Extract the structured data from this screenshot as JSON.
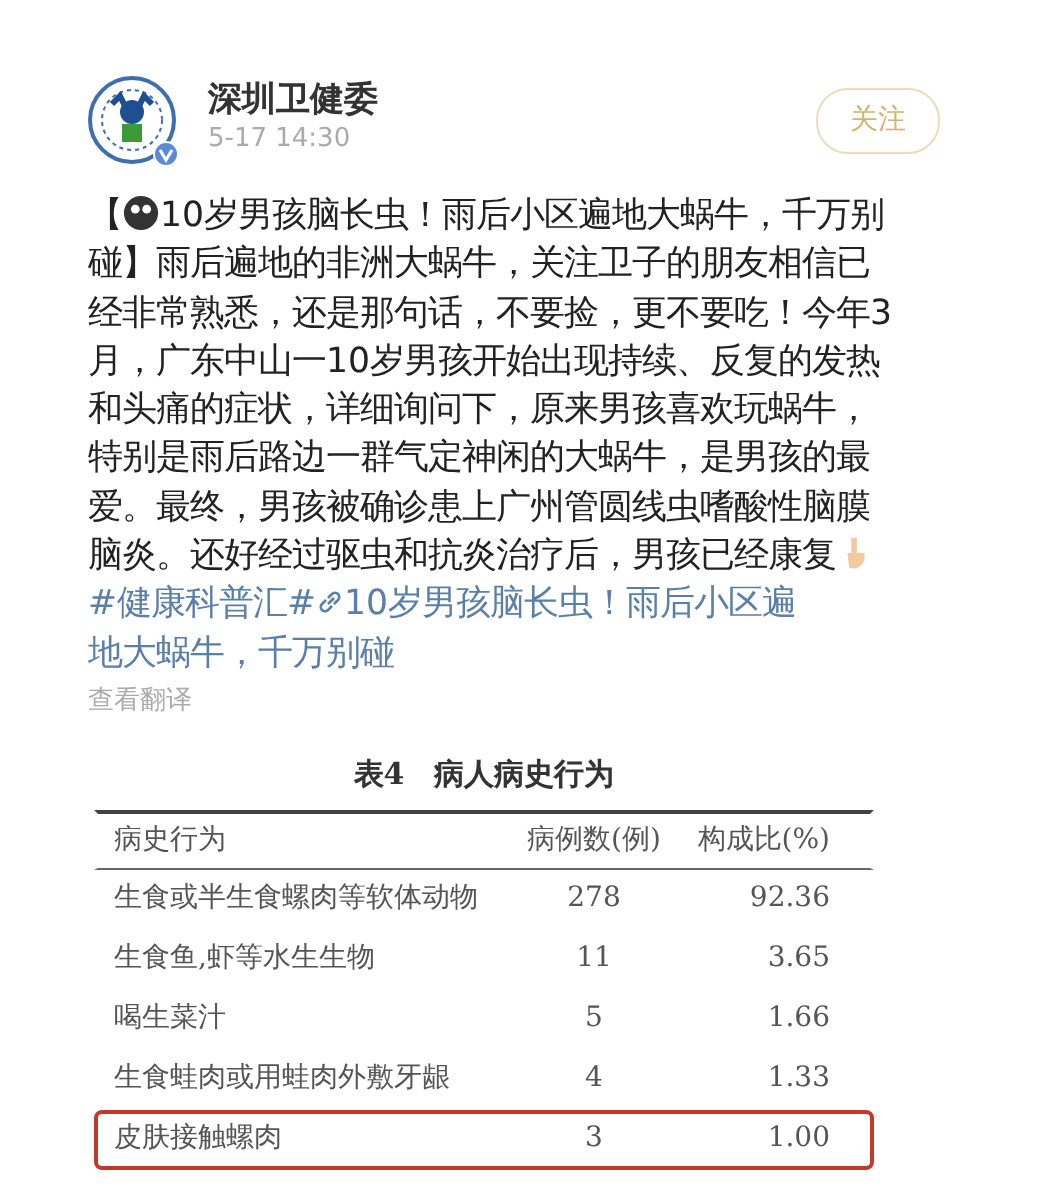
{
  "post": {
    "author": "深圳卫健委",
    "verified": true,
    "time": "5-17 14:30",
    "follow_button": "关注",
    "body": {
      "open_bracket": "【",
      "text": "10岁男孩脑长虫！雨后小区遍地大蜗牛，千万别碰】雨后遍地的非洲大蜗牛，关注卫子的朋友相信已经非常熟悉，还是那句话，不要捡，更不要吃！今年3月，广东中山一10岁男孩开始出现持续、反复的发热和头痛的症状，详细询问下，原来男孩喜欢玩蜗牛，特别是雨后路边一群气定神闲的大蜗牛，是男孩的最爱。最终，男孩被确诊患上广州管圆线虫嗜酸性脑膜脑炎。还好经过驱虫和抗炎治疗后，男孩已经康复",
      "hashtag": "#健康科普汇#",
      "link_lines": [
        "10岁男孩脑长虫！雨后小区遍",
        "地大蜗牛，千万别碰"
      ]
    },
    "translate": "查看翻译"
  },
  "table": {
    "title": "表4　病人病史行为",
    "columns": [
      "病史行为",
      "病例数(例)",
      "构成比(%)"
    ],
    "rows": [
      {
        "cells": [
          "生食或半生食螺肉等软体动物",
          "278",
          "92.36"
        ],
        "highlighted": false
      },
      {
        "cells": [
          "生食鱼,虾等水生生物",
          "11",
          "3.65"
        ],
        "highlighted": false
      },
      {
        "cells": [
          "喝生菜汁",
          "5",
          "1.66"
        ],
        "highlighted": false
      },
      {
        "cells": [
          "生食蛙肉或用蛙肉外敷牙龈",
          "4",
          "1.33"
        ],
        "highlighted": false
      },
      {
        "cells": [
          "皮肤接触螺肉",
          "3",
          "1.00"
        ],
        "highlighted": true
      }
    ]
  }
}
